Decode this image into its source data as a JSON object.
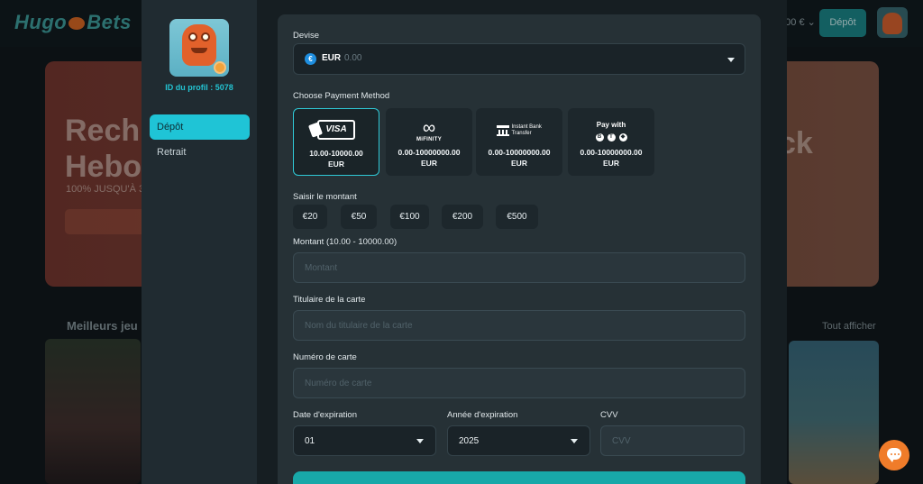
{
  "background": {
    "logo_left": "Hugo",
    "logo_right": "Bets",
    "balance": "0.00 € ⌄",
    "deposit_button": "Dépôt",
    "hero_title": "Rech\nHebo",
    "hero_sub": "100% JUSQU'À 3",
    "hero_right": "ck",
    "section_title": "Meilleurs jeu",
    "section_link": "Tout afficher"
  },
  "sidebar": {
    "profile_id": "ID du profil : 5078",
    "items": [
      {
        "label": "Dépôt",
        "active": true
      },
      {
        "label": "Retrait",
        "active": false
      }
    ]
  },
  "form": {
    "currency_label": "Devise",
    "currency": {
      "code": "EUR",
      "amount": "0.00",
      "symbol": "€",
      "icon": "euro-coin-icon"
    },
    "payment_method_label": "Choose Payment Method",
    "payment_methods": [
      {
        "name": "VISA",
        "range": "10.00-10000.00 EUR",
        "selected": true,
        "icon": "visa-card-icon"
      },
      {
        "name": "MiFINITY",
        "range": "0.00-10000000.00 EUR",
        "selected": false,
        "icon": "infinity-icon"
      },
      {
        "name": "Instant Bank Transfer",
        "range": "0.00-10000000.00 EUR",
        "selected": false,
        "icon": "bank-icon"
      },
      {
        "name": "Pay with",
        "range": "0.00-10000000.00 EUR",
        "selected": false,
        "icon": "crypto-icons"
      }
    ],
    "amount_section_label": "Saisir le montant",
    "quick_amounts": [
      "€20",
      "€50",
      "€100",
      "€200",
      "€500"
    ],
    "amount_label": "Montant (10.00 - 10000.00)",
    "amount_placeholder": "Montant",
    "holder_label": "Titulaire de la carte",
    "holder_placeholder": "Nom du titulaire de la carte",
    "card_number_label": "Numéro de carte",
    "card_number_placeholder": "Numéro de carte",
    "exp_month_label": "Date d'expiration",
    "exp_month_value": "01",
    "exp_year_label": "Année d'expiration",
    "exp_year_value": "2025",
    "cvv_label": "CVV",
    "cvv_placeholder": "CVV"
  },
  "colors": {
    "accent": "#1fc4d6",
    "panel": "#263136",
    "chat": "#f07c2a"
  }
}
